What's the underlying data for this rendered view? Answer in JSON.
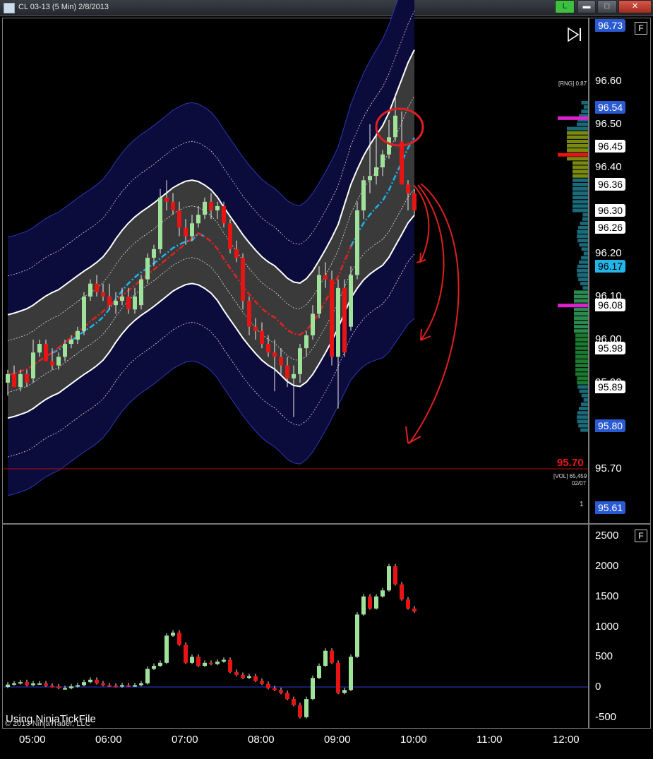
{
  "window": {
    "title": "CL 03-13 (5 Min)  2/8/2013",
    "live_button": "L",
    "minimize_glyph": "▬",
    "maximize_glyph": "□",
    "close_glyph": "✕"
  },
  "price_pane": {
    "format_button": "F",
    "axis_ticks": [
      "96.60",
      "96.50",
      "96.40",
      "96.30",
      "96.20",
      "96.10",
      "96.00",
      "95.90",
      "95.80",
      "95.70"
    ],
    "price_tags": [
      {
        "label": "96.73",
        "style": "blue"
      },
      {
        "label": "96.54",
        "style": "blue"
      },
      {
        "label": "96.45",
        "style": "white"
      },
      {
        "label": "96.36",
        "style": "white"
      },
      {
        "label": "96.30",
        "style": "white"
      },
      {
        "label": "96.26",
        "style": "white"
      },
      {
        "label": "96.17",
        "style": "cyan"
      },
      {
        "label": "96.08",
        "style": "white"
      },
      {
        "label": "95.98",
        "style": "white"
      },
      {
        "label": "95.89",
        "style": "white"
      },
      {
        "label": "95.80",
        "style": "blue"
      },
      {
        "label": "95.61",
        "style": "blue"
      }
    ],
    "range_label": "[RNG] 0.87",
    "current_price": "95.70",
    "vol_label": "[VOL] 65,459",
    "vol_date": "02/07",
    "counter": "1",
    "play_icon": "play-skip-icon"
  },
  "volume_pane": {
    "format_button": "F",
    "axis_ticks": [
      "2500",
      "2000",
      "1500",
      "1000",
      "500",
      "0",
      "-500"
    ]
  },
  "time_axis": [
    "05:00",
    "06:00",
    "07:00",
    "08:00",
    "09:00",
    "10:00",
    "11:00",
    "12:00"
  ],
  "watermark": "Using NinjaTickFile",
  "copyright": "© 2013 NinjaTrader, LLC",
  "colors": {
    "up_candle": "#9fe39a",
    "down_candle": "#e81414",
    "band_outer": "#0b0b3c",
    "band_inner": "#3a3a3a",
    "vwap_cyan": "#1fb1ea",
    "vwap_red": "#e22222",
    "annotation_red": "#e02020",
    "zero_line": "#2b3bd9"
  },
  "chart_data": {
    "type": "candlestick",
    "interval": "5 Min",
    "instrument": "CL 03-13",
    "y_range": [
      95.6,
      96.75
    ],
    "volume_range": [
      -600,
      2600
    ],
    "candles": [
      {
        "time": "04:40",
        "o": 95.9,
        "h": 95.93,
        "l": 95.87,
        "c": 95.92
      },
      {
        "time": "04:45",
        "o": 95.92,
        "h": 95.94,
        "l": 95.89,
        "c": 95.89
      },
      {
        "time": "04:50",
        "o": 95.89,
        "h": 95.93,
        "l": 95.88,
        "c": 95.92
      },
      {
        "time": "04:55",
        "o": 95.92,
        "h": 95.93,
        "l": 95.89,
        "c": 95.9
      },
      {
        "time": "05:00",
        "o": 95.91,
        "h": 96.0,
        "l": 95.9,
        "c": 95.97
      },
      {
        "time": "05:05",
        "o": 95.97,
        "h": 96.0,
        "l": 95.96,
        "c": 95.99
      },
      {
        "time": "05:10",
        "o": 95.99,
        "h": 96.0,
        "l": 95.95,
        "c": 95.95
      },
      {
        "time": "05:15",
        "o": 95.95,
        "h": 95.98,
        "l": 95.93,
        "c": 95.94
      },
      {
        "time": "05:20",
        "o": 95.94,
        "h": 95.97,
        "l": 95.93,
        "c": 95.96
      },
      {
        "time": "05:25",
        "o": 95.96,
        "h": 96.0,
        "l": 95.95,
        "c": 95.99
      },
      {
        "time": "05:30",
        "o": 95.99,
        "h": 96.01,
        "l": 95.98,
        "c": 96.0
      },
      {
        "time": "05:35",
        "o": 96.0,
        "h": 96.03,
        "l": 95.99,
        "c": 96.02
      },
      {
        "time": "05:40",
        "o": 96.02,
        "h": 96.11,
        "l": 96.01,
        "c": 96.1
      },
      {
        "time": "05:45",
        "o": 96.1,
        "h": 96.14,
        "l": 96.09,
        "c": 96.13
      },
      {
        "time": "05:50",
        "o": 96.13,
        "h": 96.15,
        "l": 96.1,
        "c": 96.11
      },
      {
        "time": "05:55",
        "o": 96.11,
        "h": 96.13,
        "l": 96.09,
        "c": 96.1
      },
      {
        "time": "06:00",
        "o": 96.1,
        "h": 96.13,
        "l": 96.07,
        "c": 96.08
      },
      {
        "time": "06:05",
        "o": 96.08,
        "h": 96.11,
        "l": 96.06,
        "c": 96.09
      },
      {
        "time": "06:10",
        "o": 96.09,
        "h": 96.12,
        "l": 96.08,
        "c": 96.1
      },
      {
        "time": "06:15",
        "o": 96.1,
        "h": 96.12,
        "l": 96.06,
        "c": 96.07
      },
      {
        "time": "06:20",
        "o": 96.07,
        "h": 96.12,
        "l": 96.06,
        "c": 96.1
      },
      {
        "time": "06:25",
        "o": 96.08,
        "h": 96.15,
        "l": 96.07,
        "c": 96.14
      },
      {
        "time": "06:30",
        "o": 96.14,
        "h": 96.2,
        "l": 96.13,
        "c": 96.19
      },
      {
        "time": "06:35",
        "o": 96.19,
        "h": 96.22,
        "l": 96.17,
        "c": 96.21
      },
      {
        "time": "06:40",
        "o": 96.21,
        "h": 96.35,
        "l": 96.2,
        "c": 96.33
      },
      {
        "time": "06:45",
        "o": 96.33,
        "h": 96.37,
        "l": 96.3,
        "c": 96.32
      },
      {
        "time": "06:50",
        "o": 96.32,
        "h": 96.34,
        "l": 96.29,
        "c": 96.3
      },
      {
        "time": "06:55",
        "o": 96.3,
        "h": 96.32,
        "l": 96.24,
        "c": 96.26
      },
      {
        "time": "07:00",
        "o": 96.26,
        "h": 96.28,
        "l": 96.22,
        "c": 96.24
      },
      {
        "time": "07:05",
        "o": 96.24,
        "h": 96.29,
        "l": 96.23,
        "c": 96.27
      },
      {
        "time": "07:10",
        "o": 96.27,
        "h": 96.31,
        "l": 96.26,
        "c": 96.29
      },
      {
        "time": "07:15",
        "o": 96.29,
        "h": 96.33,
        "l": 96.28,
        "c": 96.32
      },
      {
        "time": "07:20",
        "o": 96.32,
        "h": 96.34,
        "l": 96.28,
        "c": 96.3
      },
      {
        "time": "07:25",
        "o": 96.3,
        "h": 96.32,
        "l": 96.28,
        "c": 96.31
      },
      {
        "time": "07:30",
        "o": 96.31,
        "h": 96.32,
        "l": 96.26,
        "c": 96.27
      },
      {
        "time": "07:35",
        "o": 96.27,
        "h": 96.28,
        "l": 96.2,
        "c": 96.21
      },
      {
        "time": "07:40",
        "o": 96.21,
        "h": 96.23,
        "l": 96.18,
        "c": 96.19
      },
      {
        "time": "07:45",
        "o": 96.19,
        "h": 96.2,
        "l": 96.07,
        "c": 96.09
      },
      {
        "time": "07:50",
        "o": 96.09,
        "h": 96.1,
        "l": 96.01,
        "c": 96.03
      },
      {
        "time": "07:55",
        "o": 96.03,
        "h": 96.05,
        "l": 96.0,
        "c": 96.02
      },
      {
        "time": "08:00",
        "o": 96.02,
        "h": 96.04,
        "l": 95.98,
        "c": 95.99
      },
      {
        "time": "08:05",
        "o": 95.99,
        "h": 96.01,
        "l": 95.96,
        "c": 95.97
      },
      {
        "time": "08:10",
        "o": 95.97,
        "h": 96.0,
        "l": 95.88,
        "c": 95.96
      },
      {
        "time": "08:15",
        "o": 95.96,
        "h": 95.98,
        "l": 95.92,
        "c": 95.94
      },
      {
        "time": "08:20",
        "o": 95.94,
        "h": 95.96,
        "l": 95.89,
        "c": 95.91
      },
      {
        "time": "08:25",
        "o": 95.91,
        "h": 95.94,
        "l": 95.82,
        "c": 95.92
      },
      {
        "time": "08:30",
        "o": 95.92,
        "h": 95.99,
        "l": 95.9,
        "c": 95.98
      },
      {
        "time": "08:35",
        "o": 95.98,
        "h": 96.02,
        "l": 95.96,
        "c": 96.01
      },
      {
        "time": "08:40",
        "o": 96.01,
        "h": 96.08,
        "l": 96.0,
        "c": 96.06
      },
      {
        "time": "08:45",
        "o": 96.06,
        "h": 96.17,
        "l": 96.05,
        "c": 96.15
      },
      {
        "time": "08:50",
        "o": 96.15,
        "h": 96.18,
        "l": 96.12,
        "c": 96.14
      },
      {
        "time": "08:55",
        "o": 96.14,
        "h": 96.16,
        "l": 95.94,
        "c": 95.96
      },
      {
        "time": "09:00",
        "o": 95.96,
        "h": 96.14,
        "l": 95.84,
        "c": 96.12
      },
      {
        "time": "09:05",
        "o": 96.12,
        "h": 96.14,
        "l": 95.96,
        "c": 95.97
      },
      {
        "time": "09:10",
        "o": 96.03,
        "h": 96.17,
        "l": 96.02,
        "c": 96.15
      },
      {
        "time": "09:15",
        "o": 96.15,
        "h": 96.32,
        "l": 96.14,
        "c": 96.3
      },
      {
        "time": "09:20",
        "o": 96.3,
        "h": 96.38,
        "l": 96.28,
        "c": 96.37
      },
      {
        "time": "09:25",
        "o": 96.37,
        "h": 96.5,
        "l": 96.34,
        "c": 96.38
      },
      {
        "time": "09:30",
        "o": 96.38,
        "h": 96.48,
        "l": 96.36,
        "c": 96.4
      },
      {
        "time": "09:35",
        "o": 96.4,
        "h": 96.44,
        "l": 96.38,
        "c": 96.43
      },
      {
        "time": "09:40",
        "o": 96.43,
        "h": 96.51,
        "l": 96.42,
        "c": 96.47
      },
      {
        "time": "09:45",
        "o": 96.47,
        "h": 96.57,
        "l": 96.46,
        "c": 96.52
      },
      {
        "time": "09:50",
        "o": 96.46,
        "h": 96.53,
        "l": 96.4,
        "c": 96.36
      },
      {
        "time": "09:55",
        "o": 96.36,
        "h": 96.37,
        "l": 96.3,
        "c": 96.34
      },
      {
        "time": "10:00",
        "o": 96.34,
        "h": 96.35,
        "l": 96.29,
        "c": 96.3
      }
    ],
    "volume_candles_high": [
      40,
      60,
      80,
      30,
      60,
      60,
      20,
      10,
      -20,
      -20,
      10,
      30,
      80,
      120,
      60,
      30,
      20,
      10,
      30,
      20,
      30,
      60,
      300,
      350,
      400,
      850,
      900,
      700,
      400,
      500,
      350,
      400,
      380,
      420,
      450,
      250,
      200,
      150,
      180,
      100,
      50,
      -20,
      -50,
      -100,
      -200,
      -300,
      -500,
      -200,
      150,
      350,
      600,
      400,
      -100,
      -50,
      500,
      1200,
      1500,
      1300,
      1500,
      1600,
      2000,
      1700,
      1450,
      1300,
      1250
    ]
  }
}
